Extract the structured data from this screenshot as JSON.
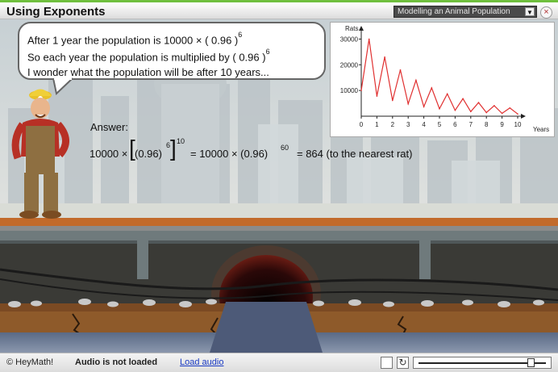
{
  "window": {
    "title": "Using Exponents",
    "menu_selected": "Modelling an Animal Population",
    "close_symbol": "×"
  },
  "bubble": {
    "line1_text": "After 1 year the population is  10000 × ( 0.96 )",
    "line1_exp": "6",
    "line2_text": "So each year the population is multiplied by  ( 0.96 )",
    "line2_exp": "6",
    "line3_text": "I wonder what the population will be after 10 years..."
  },
  "answer": {
    "label": "Answer:",
    "part1": "10000 ×",
    "base": "(0.96)",
    "inner_exp": "6",
    "outer_exp": "10",
    "part2": "= 10000 × (0.96)",
    "part2_exp": "60",
    "part3": "= 864 (to the nearest rat)"
  },
  "chart_data": {
    "type": "line",
    "ylabel": "Rats",
    "xlabel": "Years",
    "xlim": [
      0,
      10
    ],
    "ylim": [
      0,
      32000
    ],
    "x_ticks": [
      "0",
      "1",
      "2",
      "3",
      "4",
      "5",
      "6",
      "7",
      "8",
      "9",
      "10"
    ],
    "y_ticks": [
      "10000",
      "20000",
      "30000"
    ],
    "series": [
      {
        "color": "#e03030",
        "x": [
          0,
          0.5,
          1,
          1.5,
          2,
          2.5,
          3,
          3.5,
          4,
          4.5,
          5,
          5.5,
          6,
          6.5,
          7,
          7.5,
          8,
          8.5,
          9,
          9.5,
          10
        ],
        "y": [
          10000,
          30000,
          7800,
          23000,
          6100,
          18000,
          4800,
          14000,
          3700,
          11000,
          2900,
          8700,
          2300,
          6800,
          1800,
          5300,
          1400,
          4100,
          1100,
          3200,
          864
        ]
      }
    ]
  },
  "footer": {
    "copyright": "© HeyMath!",
    "audio_status": "Audio is not loaded",
    "load_audio": "Load audio",
    "replay_symbol": "↻"
  },
  "colors": {
    "accent": "#6fbf3e",
    "line": "#e03030",
    "link": "#1a3bc4"
  }
}
